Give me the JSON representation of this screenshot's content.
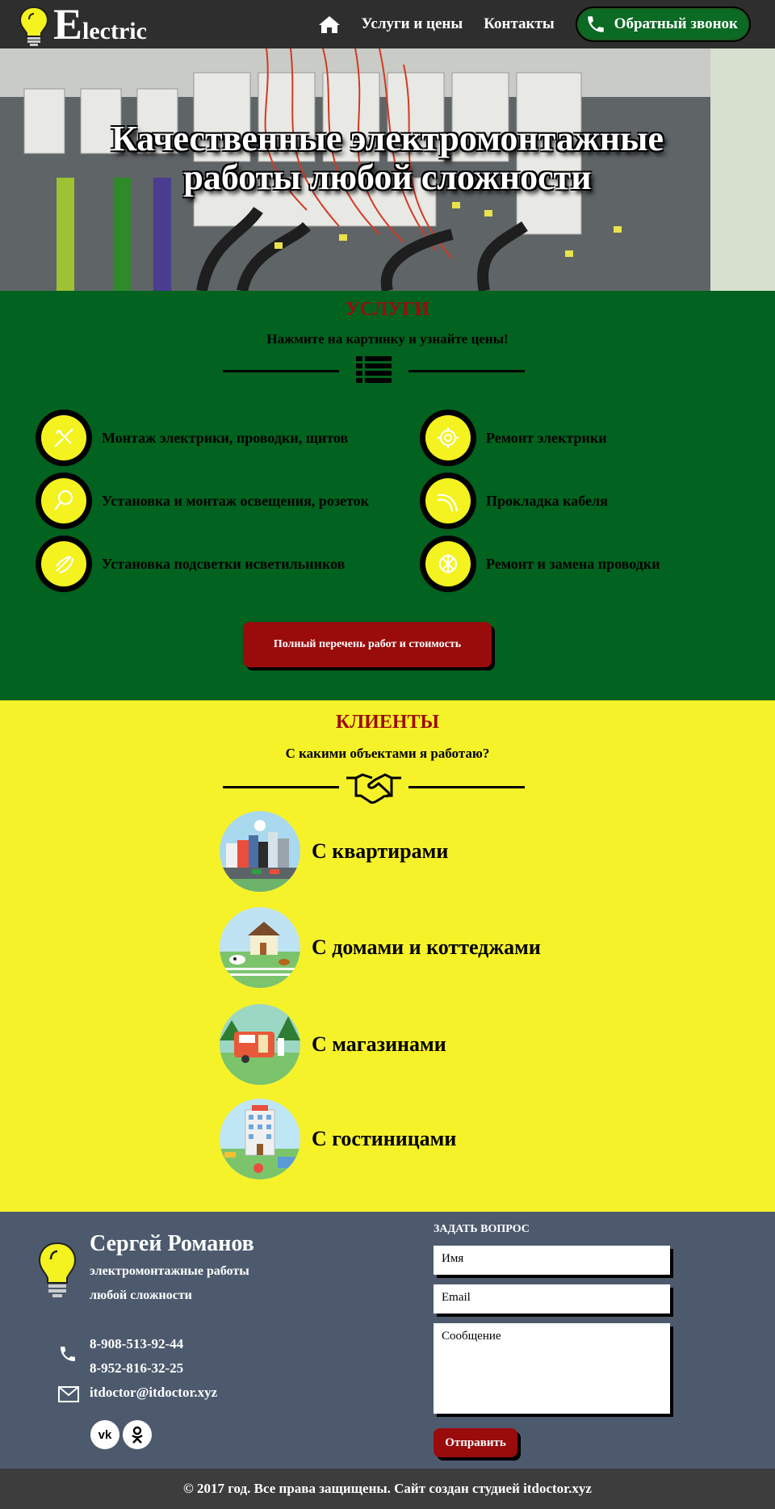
{
  "header": {
    "logo_letter": "E",
    "logo_rest": "lectric",
    "nav": {
      "home_icon": "home-icon",
      "services_label": "Услуги и цены",
      "contacts_label": "Контакты",
      "callback_label": "Обратный звонок",
      "callback_icon": "phone-icon"
    }
  },
  "hero": {
    "title_line1": "Качественные электромонтажные",
    "title_line2": "работы любой сложности"
  },
  "services": {
    "title": "УСЛУГИ",
    "subtitle": "Нажмите на картинку и узнайте цены!",
    "divider_icon": "list-icon",
    "items": [
      {
        "label": "Монтаж электрики, проводки, щитов",
        "icon": "pliers-icon"
      },
      {
        "label": "Ремонт электрики",
        "icon": "wire-coil-icon"
      },
      {
        "label": "Установка и монтаж освещения, розеток",
        "icon": "lightbulb-icon"
      },
      {
        "label": "Прокладка кабеля",
        "icon": "cable-icon"
      },
      {
        "label": "Установка подсветки исветильников",
        "icon": "lamp-icon"
      },
      {
        "label": "Ремонт и замена проводки",
        "icon": "wiring-icon"
      }
    ],
    "button_label": "Полный перечень работ и стоимость"
  },
  "clients": {
    "title": "КЛИЕНТЫ",
    "subtitle": "С какими объектами я работаю?",
    "divider_icon": "handshake-icon",
    "items": [
      {
        "label": "С квартирами",
        "icon": "city-buildings-icon"
      },
      {
        "label": "С домами и коттеджами",
        "icon": "country-house-icon"
      },
      {
        "label": "С магазинами",
        "icon": "shop-trailer-icon"
      },
      {
        "label": "С гостиницами",
        "icon": "hotel-icon"
      }
    ]
  },
  "footer": {
    "name": "Сергей Романов",
    "desc_line1": "электромонтажные работы",
    "desc_line2": "любой сложности",
    "phone1": "8-908-513-92-44",
    "phone2": "8-952-816-32-25",
    "email": "itdoctor@itdoctor.xyz",
    "social_vk": "vk",
    "social_ok": "ok",
    "form": {
      "title": "ЗАДАТЬ ВОПРОС",
      "name_placeholder": "Имя",
      "email_placeholder": "Email",
      "message_placeholder": "Сообщение",
      "submit_label": "Отправить"
    },
    "copyright": "© 2017 год. Все права защищены. Сайт создан студией itdoctor.xyz"
  },
  "colors": {
    "header_bg": "#2e2e2e",
    "services_bg": "#02621f",
    "clients_bg": "#f6f22a",
    "footer_bg": "#4d5a6e",
    "accent_red": "#9a0b0b",
    "accent_yellow": "#f4f21f"
  }
}
